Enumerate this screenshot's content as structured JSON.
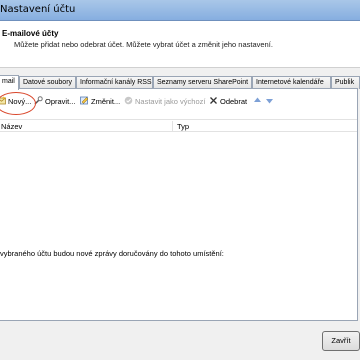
{
  "window": {
    "title": "Nastavení účtu"
  },
  "header": {
    "title": "E-mailové účty",
    "description": "Můžete přidat nebo odebrat účet. Můžete vybrat účet a změnit jeho nastavení."
  },
  "tabs": [
    {
      "label": "mail",
      "active": true
    },
    {
      "label": "Datové soubory",
      "active": false
    },
    {
      "label": "Informační kanály RSS",
      "active": false
    },
    {
      "label": "Seznamy serveru SharePoint",
      "active": false
    },
    {
      "label": "Internetové kalendáře",
      "active": false
    },
    {
      "label": "Publik",
      "active": false
    }
  ],
  "toolbar": {
    "new_label": "Nový...",
    "repair_label": "Opravit...",
    "change_label": "Změnit...",
    "set_default_label": "Nastavit jako výchozí",
    "remove_label": "Odebrat"
  },
  "list": {
    "columns": [
      "Název",
      "Typ"
    ],
    "rows": []
  },
  "delivery_text": "vybraného účtu budou nové zprávy doručovány do tohoto umístění:",
  "footer": {
    "close_label": "Zavřít"
  },
  "colors": {
    "highlight_ellipse": "#d9462a",
    "titlebar": "#86aee0"
  }
}
